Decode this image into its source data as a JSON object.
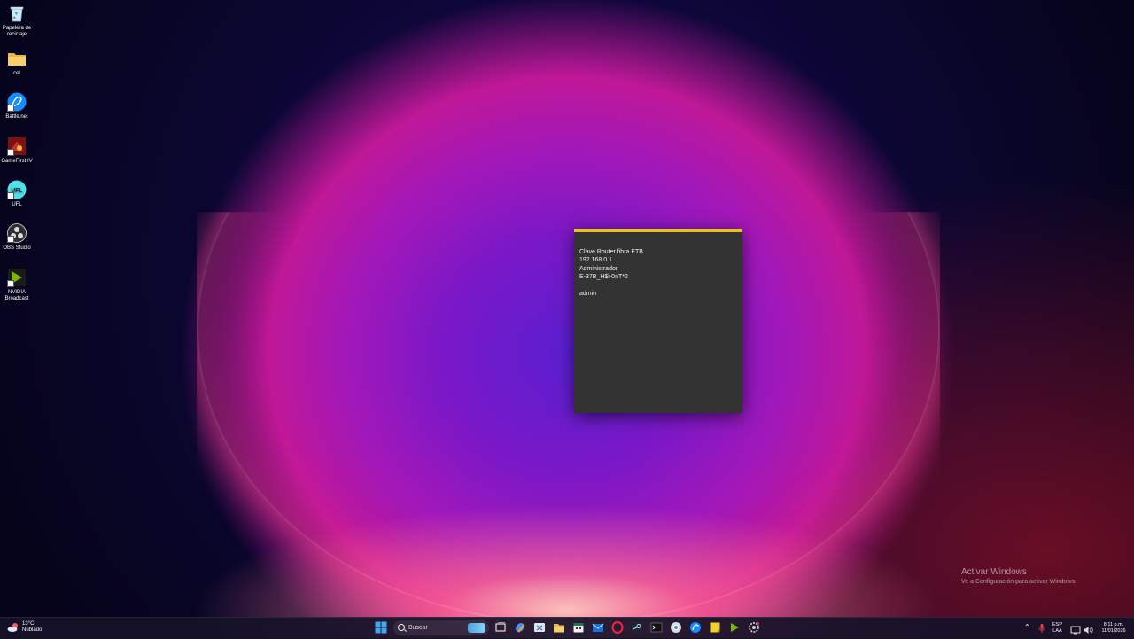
{
  "desktop": {
    "icons": [
      {
        "label": "Papelera de reciclaje",
        "icon": "recycle-bin-icon"
      },
      {
        "label": "cel",
        "icon": "folder-icon"
      },
      {
        "label": "Battle.net",
        "icon": "battlenet-icon"
      },
      {
        "label": "GameFirst IV",
        "icon": "gamefirst-icon"
      },
      {
        "label": "UFL",
        "icon": "ufl-icon"
      },
      {
        "label": "OBS Studio",
        "icon": "obs-icon"
      },
      {
        "label": "NVIDIA Broadcast",
        "icon": "nvidia-broadcast-icon"
      }
    ]
  },
  "sticky_note": {
    "accent_color": "#e8c022",
    "text": "Clave Router fibra ETB\n192.168.0.1\nAdministrador\nE-37B_H$i-0nT*2\n\nadmin"
  },
  "activation": {
    "title": "Activar Windows",
    "subtitle": "Ve a Configuración para activar Windows."
  },
  "taskbar": {
    "weather": {
      "temp": "13°C",
      "condition": "Nublado"
    },
    "search_placeholder": "Buscar",
    "apps": [
      "start-icon",
      "task-view-icon",
      "copilot-icon",
      "snipping-tool-icon",
      "file-explorer-icon",
      "calendar-icon",
      "mail-icon",
      "opera-icon",
      "steam-icon",
      "terminal-icon",
      "chrome-icon",
      "battlenet-icon",
      "sticky-notes-icon",
      "nvidia-icon",
      "settings-icon"
    ],
    "tray": {
      "language": "ESP",
      "layout": "LAA",
      "time": "8:11 p.m.",
      "date": "11/01/2026"
    }
  }
}
